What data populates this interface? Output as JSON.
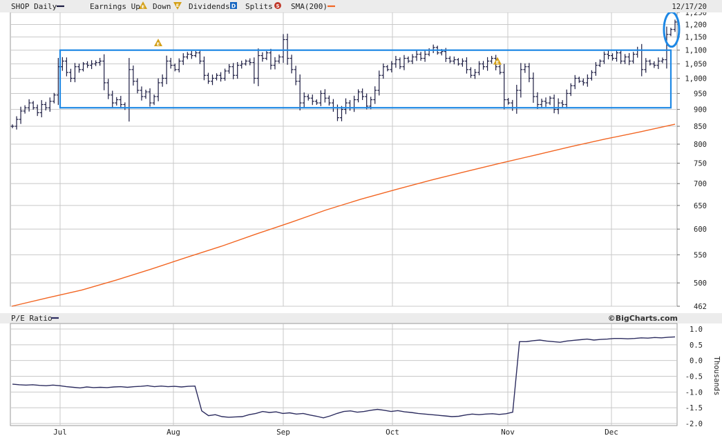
{
  "header": {
    "ticker_label": "SHOP Daily",
    "earnings_label": "Earnings Up",
    "earnings_down_label": "Down",
    "dividends_label": "Dividends",
    "splits_label": "Splits",
    "sma_label": "SMA(200)",
    "date": "12/17/20",
    "earnings_up_glyph": "E",
    "earnings_down_glyph": "E",
    "dividend_glyph": "D",
    "split_glyph": "S"
  },
  "colors": {
    "price_bars": "#1a1a40",
    "sma": "#f26522",
    "pe_line": "#2b2b5e",
    "highlight": "#1e88e5",
    "grid": "#c8c8c8",
    "earnings_icon": "#d4a017",
    "dividend_icon": "#1565c0",
    "split_icon": "#c0392b"
  },
  "pe_panel": {
    "label": "P/E Ratio",
    "credit": "©BigCharts.com",
    "axis_unit": "Thousands"
  },
  "chart_data": [
    {
      "type": "ohlc",
      "title": "SHOP Daily",
      "x_months": [
        "Jul",
        "Aug",
        "Sep",
        "Oct",
        "Nov",
        "Dec"
      ],
      "y_ticks": [
        462,
        500,
        550,
        600,
        650,
        700,
        750,
        800,
        850,
        900,
        950,
        1000,
        1050,
        1100,
        1150,
        1200,
        1250
      ],
      "y_tick_labels": [
        "462",
        "500",
        "550",
        "600",
        "650",
        "700",
        "750",
        "800",
        "850",
        "900",
        "950",
        "1,000",
        "1,050",
        "1,100",
        "1,150",
        "1,200",
        "1,250"
      ],
      "ylim": [
        462,
        1250
      ],
      "scale": "log",
      "grid": true,
      "closes": [
        850,
        870,
        895,
        905,
        920,
        905,
        890,
        915,
        905,
        925,
        945,
        1040,
        1060,
        1020,
        1000,
        1040,
        1030,
        1050,
        1045,
        1050,
        1055,
        1060,
        985,
        945,
        920,
        930,
        915,
        905,
        1030,
        990,
        960,
        940,
        955,
        920,
        940,
        985,
        1000,
        1060,
        1045,
        1030,
        1060,
        1075,
        1085,
        1080,
        1090,
        1060,
        1010,
        990,
        1000,
        1010,
        1000,
        1025,
        1040,
        1010,
        1045,
        1050,
        1060,
        1055,
        1000,
        1080,
        1070,
        1090,
        1045,
        1060,
        1075,
        1140,
        1070,
        1030,
        990,
        920,
        940,
        935,
        925,
        920,
        950,
        935,
        920,
        905,
        875,
        900,
        920,
        905,
        930,
        955,
        940,
        910,
        930,
        960,
        1010,
        1040,
        1030,
        1050,
        1065,
        1040,
        1070,
        1060,
        1075,
        1085,
        1070,
        1085,
        1100,
        1110,
        1090,
        1095,
        1070,
        1060,
        1065,
        1050,
        1060,
        1030,
        1010,
        1020,
        1050,
        1040,
        1060,
        1070,
        1040,
        1020,
        930,
        920,
        905,
        960,
        1030,
        1040,
        1000,
        940,
        915,
        925,
        920,
        935,
        900,
        920,
        915,
        950,
        975,
        1000,
        990,
        985,
        1000,
        1020,
        1045,
        1060,
        1085,
        1080,
        1070,
        1090,
        1060,
        1075,
        1060,
        1085,
        1100,
        1030,
        1060,
        1050,
        1045,
        1060,
        1065,
        1160,
        1180,
        1210
      ],
      "sma200": [
        462,
        475,
        488,
        505,
        524,
        545,
        566,
        590,
        614,
        640,
        664,
        686,
        708,
        729,
        750,
        771,
        793,
        814,
        834,
        856
      ],
      "highlight_box": {
        "low": 905,
        "high": 1100
      },
      "earnings_markers": [
        "Jul 29",
        "Oct 29"
      ]
    },
    {
      "type": "line",
      "title": "P/E Ratio",
      "ylabel": "Thousands",
      "y_ticks": [
        -2.0,
        -1.5,
        -1.0,
        -0.5,
        0.0,
        0.5,
        1.0
      ],
      "y_tick_labels": [
        "-2.0",
        "-1.5",
        "-1.0",
        "-0.5",
        "0.0",
        "0.5",
        "1.0"
      ],
      "ylim": [
        -2.0,
        1.0
      ],
      "grid": true,
      "values": [
        -0.75,
        -0.77,
        -0.78,
        -0.77,
        -0.79,
        -0.8,
        -0.78,
        -0.8,
        -0.83,
        -0.85,
        -0.87,
        -0.84,
        -0.86,
        -0.85,
        -0.86,
        -0.84,
        -0.83,
        -0.85,
        -0.83,
        -0.82,
        -0.8,
        -0.83,
        -0.81,
        -0.83,
        -0.82,
        -0.84,
        -0.82,
        -0.81,
        -1.6,
        -1.75,
        -1.72,
        -1.78,
        -1.8,
        -1.79,
        -1.78,
        -1.72,
        -1.68,
        -1.62,
        -1.65,
        -1.63,
        -1.68,
        -1.66,
        -1.7,
        -1.68,
        -1.73,
        -1.77,
        -1.82,
        -1.76,
        -1.68,
        -1.62,
        -1.6,
        -1.64,
        -1.62,
        -1.58,
        -1.55,
        -1.58,
        -1.62,
        -1.59,
        -1.63,
        -1.65,
        -1.68,
        -1.7,
        -1.72,
        -1.74,
        -1.76,
        -1.78,
        -1.77,
        -1.73,
        -1.7,
        -1.72,
        -1.7,
        -1.69,
        -1.71,
        -1.69,
        -1.64,
        0.6,
        0.6,
        0.63,
        0.65,
        0.62,
        0.6,
        0.58,
        0.62,
        0.64,
        0.66,
        0.68,
        0.65,
        0.67,
        0.68,
        0.7,
        0.7,
        0.69,
        0.7,
        0.72,
        0.71,
        0.73,
        0.72,
        0.74,
        0.75
      ]
    }
  ]
}
